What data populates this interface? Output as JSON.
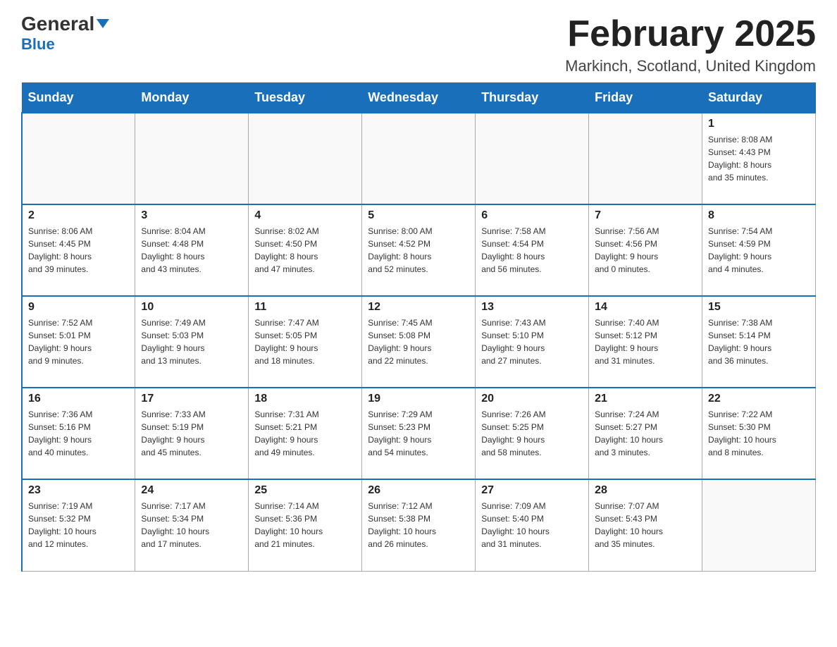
{
  "header": {
    "logo": {
      "general": "General",
      "blue": "Blue",
      "tagline": ""
    },
    "title": "February 2025",
    "location": "Markinch, Scotland, United Kingdom"
  },
  "weekdays": [
    "Sunday",
    "Monday",
    "Tuesday",
    "Wednesday",
    "Thursday",
    "Friday",
    "Saturday"
  ],
  "weeks": [
    [
      {
        "day": "",
        "info": ""
      },
      {
        "day": "",
        "info": ""
      },
      {
        "day": "",
        "info": ""
      },
      {
        "day": "",
        "info": ""
      },
      {
        "day": "",
        "info": ""
      },
      {
        "day": "",
        "info": ""
      },
      {
        "day": "1",
        "info": "Sunrise: 8:08 AM\nSunset: 4:43 PM\nDaylight: 8 hours\nand 35 minutes."
      }
    ],
    [
      {
        "day": "2",
        "info": "Sunrise: 8:06 AM\nSunset: 4:45 PM\nDaylight: 8 hours\nand 39 minutes."
      },
      {
        "day": "3",
        "info": "Sunrise: 8:04 AM\nSunset: 4:48 PM\nDaylight: 8 hours\nand 43 minutes."
      },
      {
        "day": "4",
        "info": "Sunrise: 8:02 AM\nSunset: 4:50 PM\nDaylight: 8 hours\nand 47 minutes."
      },
      {
        "day": "5",
        "info": "Sunrise: 8:00 AM\nSunset: 4:52 PM\nDaylight: 8 hours\nand 52 minutes."
      },
      {
        "day": "6",
        "info": "Sunrise: 7:58 AM\nSunset: 4:54 PM\nDaylight: 8 hours\nand 56 minutes."
      },
      {
        "day": "7",
        "info": "Sunrise: 7:56 AM\nSunset: 4:56 PM\nDaylight: 9 hours\nand 0 minutes."
      },
      {
        "day": "8",
        "info": "Sunrise: 7:54 AM\nSunset: 4:59 PM\nDaylight: 9 hours\nand 4 minutes."
      }
    ],
    [
      {
        "day": "9",
        "info": "Sunrise: 7:52 AM\nSunset: 5:01 PM\nDaylight: 9 hours\nand 9 minutes."
      },
      {
        "day": "10",
        "info": "Sunrise: 7:49 AM\nSunset: 5:03 PM\nDaylight: 9 hours\nand 13 minutes."
      },
      {
        "day": "11",
        "info": "Sunrise: 7:47 AM\nSunset: 5:05 PM\nDaylight: 9 hours\nand 18 minutes."
      },
      {
        "day": "12",
        "info": "Sunrise: 7:45 AM\nSunset: 5:08 PM\nDaylight: 9 hours\nand 22 minutes."
      },
      {
        "day": "13",
        "info": "Sunrise: 7:43 AM\nSunset: 5:10 PM\nDaylight: 9 hours\nand 27 minutes."
      },
      {
        "day": "14",
        "info": "Sunrise: 7:40 AM\nSunset: 5:12 PM\nDaylight: 9 hours\nand 31 minutes."
      },
      {
        "day": "15",
        "info": "Sunrise: 7:38 AM\nSunset: 5:14 PM\nDaylight: 9 hours\nand 36 minutes."
      }
    ],
    [
      {
        "day": "16",
        "info": "Sunrise: 7:36 AM\nSunset: 5:16 PM\nDaylight: 9 hours\nand 40 minutes."
      },
      {
        "day": "17",
        "info": "Sunrise: 7:33 AM\nSunset: 5:19 PM\nDaylight: 9 hours\nand 45 minutes."
      },
      {
        "day": "18",
        "info": "Sunrise: 7:31 AM\nSunset: 5:21 PM\nDaylight: 9 hours\nand 49 minutes."
      },
      {
        "day": "19",
        "info": "Sunrise: 7:29 AM\nSunset: 5:23 PM\nDaylight: 9 hours\nand 54 minutes."
      },
      {
        "day": "20",
        "info": "Sunrise: 7:26 AM\nSunset: 5:25 PM\nDaylight: 9 hours\nand 58 minutes."
      },
      {
        "day": "21",
        "info": "Sunrise: 7:24 AM\nSunset: 5:27 PM\nDaylight: 10 hours\nand 3 minutes."
      },
      {
        "day": "22",
        "info": "Sunrise: 7:22 AM\nSunset: 5:30 PM\nDaylight: 10 hours\nand 8 minutes."
      }
    ],
    [
      {
        "day": "23",
        "info": "Sunrise: 7:19 AM\nSunset: 5:32 PM\nDaylight: 10 hours\nand 12 minutes."
      },
      {
        "day": "24",
        "info": "Sunrise: 7:17 AM\nSunset: 5:34 PM\nDaylight: 10 hours\nand 17 minutes."
      },
      {
        "day": "25",
        "info": "Sunrise: 7:14 AM\nSunset: 5:36 PM\nDaylight: 10 hours\nand 21 minutes."
      },
      {
        "day": "26",
        "info": "Sunrise: 7:12 AM\nSunset: 5:38 PM\nDaylight: 10 hours\nand 26 minutes."
      },
      {
        "day": "27",
        "info": "Sunrise: 7:09 AM\nSunset: 5:40 PM\nDaylight: 10 hours\nand 31 minutes."
      },
      {
        "day": "28",
        "info": "Sunrise: 7:07 AM\nSunset: 5:43 PM\nDaylight: 10 hours\nand 35 minutes."
      },
      {
        "day": "",
        "info": ""
      }
    ]
  ]
}
